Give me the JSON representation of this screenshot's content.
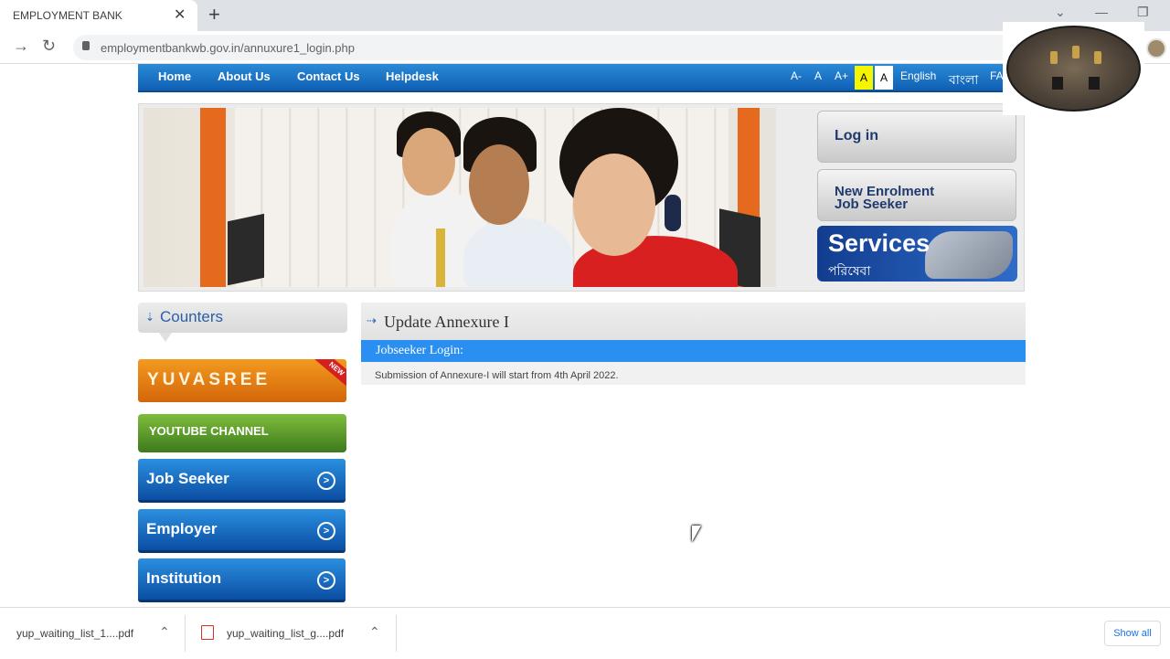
{
  "browser": {
    "tab_title": "EMPLOYMENT BANK",
    "tab_close": "✕",
    "new_tab": "+",
    "url": "employmentbankwb.gov.in/annuxure1_login.php",
    "back": "→",
    "reload": "↻"
  },
  "nav": {
    "items": [
      {
        "label": "Home"
      },
      {
        "label": "About Us"
      },
      {
        "label": "Contact Us"
      },
      {
        "label": "Helpdesk"
      }
    ],
    "font_controls": [
      "A-",
      "A",
      "A+",
      "A",
      "A"
    ],
    "lang_english": "English",
    "lang_bangla": "বাংলা",
    "faq": "FA"
  },
  "sidebar_right": {
    "login": "Log in",
    "enrol_line1": "New Enrolment",
    "enrol_line2": "Job Seeker",
    "services_title": "Services",
    "services_sub": "পরিষেবা"
  },
  "sidebar_left": {
    "counters": "Counters",
    "yuvasree": "YUVASREE",
    "new_badge": "NEW",
    "youtube": "YOUTUBE CHANNEL",
    "buttons": [
      {
        "label": "Job Seeker"
      },
      {
        "label": "Employer"
      },
      {
        "label": "Institution"
      }
    ]
  },
  "main": {
    "title": "Update Annexure I",
    "login_bar": "Jobseeker Login:",
    "notice": "Submission of Annexure-I will start from 4th April 2022."
  },
  "downloads": {
    "items": [
      {
        "name": "yup_waiting_list_1....pdf"
      },
      {
        "name": "yup_waiting_list_g....pdf"
      }
    ],
    "show_all": "Show all"
  },
  "colors": {
    "nav_blue": "#0f5fb3",
    "login_bar": "#2a8ff0",
    "yuvasree_orange": "#d4660a",
    "youtube_green": "#3d7a1c"
  }
}
